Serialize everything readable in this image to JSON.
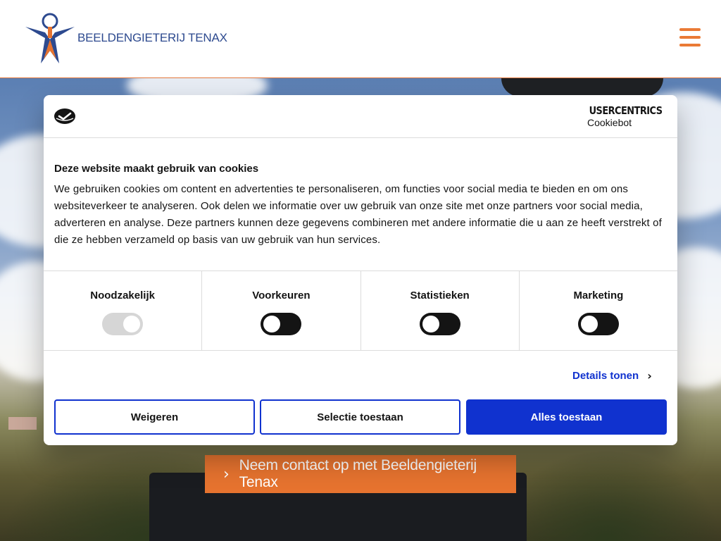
{
  "header": {
    "brand": "BEELDENGIETERIJ TENAX",
    "menu_icon": "hamburger-icon"
  },
  "colors": {
    "brand_blue": "#2d4a8f",
    "brand_orange": "#e6732f",
    "cookiebot_blue": "#1032cf"
  },
  "cta": {
    "label": "Neem contact op met Beeldengieterij Tenax",
    "icon": "chevron-right-icon"
  },
  "cookie_dialog": {
    "provider_top": "USERCENTRICS",
    "provider_bottom": "Cookiebot",
    "title": "Deze website maakt gebruik van cookies",
    "body": "We gebruiken cookies om content en advertenties te personaliseren, om functies voor social media te bieden en om ons websiteverkeer te analyseren. Ook delen we informatie over uw gebruik van onze site met onze partners voor social media, adverteren en analyse. Deze partners kunnen deze gegevens combineren met andere informatie die u aan ze heeft verstrekt of die ze hebben verzameld op basis van uw gebruik van hun services.",
    "categories": [
      {
        "label": "Noodzakelijk",
        "enabled": true,
        "locked": true
      },
      {
        "label": "Voorkeuren",
        "enabled": false,
        "locked": false
      },
      {
        "label": "Statistieken",
        "enabled": false,
        "locked": false
      },
      {
        "label": "Marketing",
        "enabled": false,
        "locked": false
      }
    ],
    "details_label": "Details tonen",
    "buttons": {
      "reject": "Weigeren",
      "selection": "Selectie toestaan",
      "accept_all": "Alles toestaan"
    }
  }
}
